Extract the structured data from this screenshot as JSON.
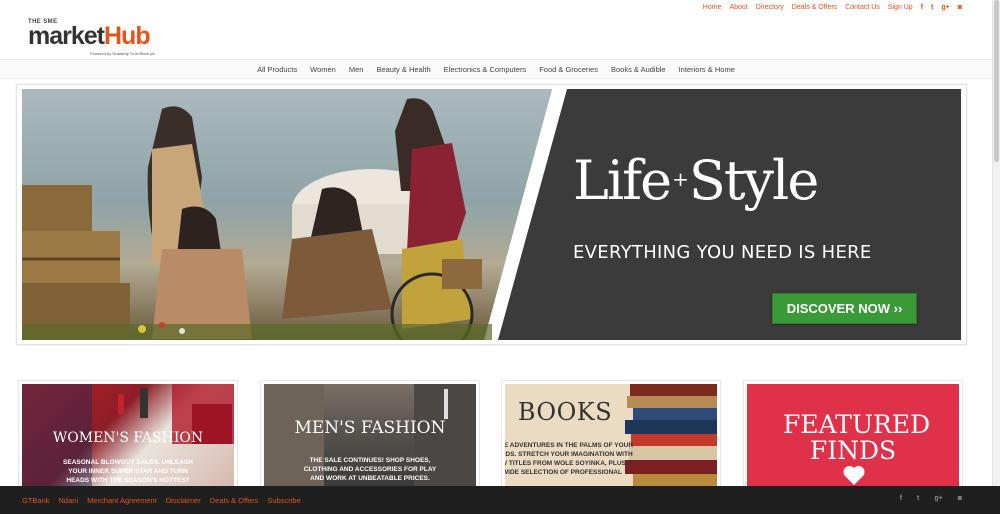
{
  "brand": {
    "pre": "THE SME",
    "market": "market",
    "hub": "Hub",
    "tagline": "Powered by Guaranty Trust Bank plc"
  },
  "topnav": [
    "Home",
    "About",
    "Directory",
    "Deals & Offers",
    "Contact Us",
    "Sign Up"
  ],
  "social_icons": [
    "facebook-icon",
    "twitter-icon",
    "google-plus-icon",
    "instagram-icon"
  ],
  "social_glyphs": {
    "facebook": "f",
    "twitter": "t",
    "google": "g+",
    "instagram": "◙"
  },
  "categories": [
    "All Products",
    "Women",
    "Men",
    "Beauty & Health",
    "Electronics & Computers",
    "Food & Groceries",
    "Books & Audible",
    "Interiors & Home"
  ],
  "hero": {
    "title_left": "Life",
    "plus": "+",
    "title_right": "Style",
    "subtitle": "EVERYTHING YOU NEED IS HERE",
    "button": "DISCOVER NOW ››"
  },
  "cards": [
    {
      "title": "WOMEN'S FASHION",
      "desc": "SEASONAL BLOWOUT SALES. UNLEASH YOUR INNER SUPER STAR AND TURN HEADS WITH THE SEASON'S HOTTEST STYLE PICKS."
    },
    {
      "title": "MEN'S FASHION",
      "desc": "THE SALE CONTINUES! SHOP SHOES, CLOTHING AND ACCESSORIES FOR PLAY AND WORK AT UNBEATABLE PRICES."
    },
    {
      "title": "BOOKS",
      "desc": "TAKE ADVENTURES IN THE PALMS OF YOUR HANDS. STRETCH YOUR IMAGINATION WITH NEW TITLES FROM WOLE SOYINKA, PLUS A WIDE SELECTION OF PROFESSIONAL"
    },
    {
      "title": "FEATURED FINDS",
      "desc": ""
    }
  ],
  "footer": [
    "GTBank",
    "Ndani",
    "Merchant Agreement",
    "Disclaimer",
    "Deals & Offers",
    "Subscribe"
  ],
  "colors": {
    "accent": "#e2541b",
    "hero_bg": "#3b3b3b",
    "button_green": "#3a9a37",
    "featured_red": "#e0314b",
    "footer_bg": "#1f1f1f"
  }
}
